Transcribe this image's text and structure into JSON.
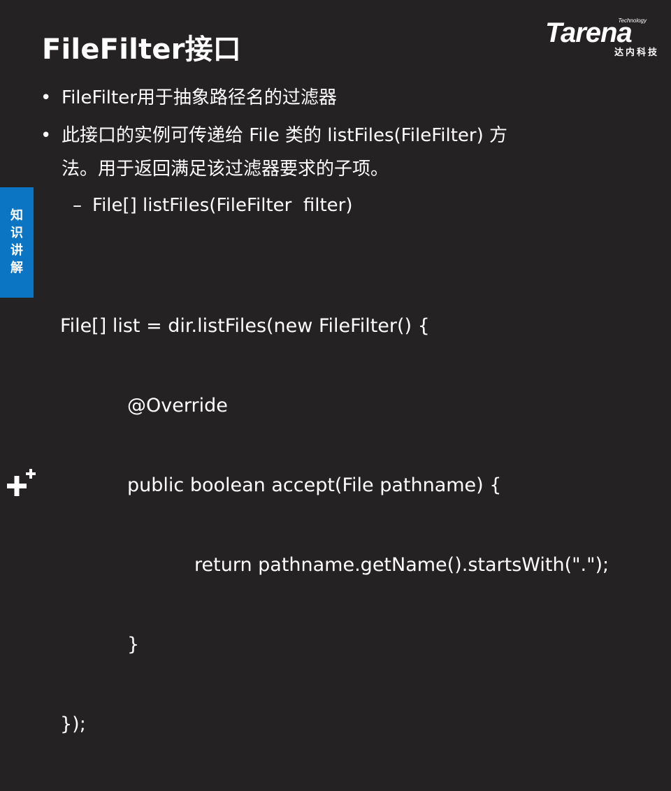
{
  "slide": {
    "title": "FileFilter接口",
    "logo": {
      "technology": "Technology",
      "wordmark": "Tarena",
      "chinese": "达内科技"
    },
    "side_tab": [
      "知",
      "识",
      "讲",
      "解"
    ],
    "bullets": [
      {
        "marker": "•",
        "text": "FileFilter用于抽象路径名的过滤器"
      },
      {
        "marker": "•",
        "line1": "此接口的实例可传递给 File 类的 listFiles(FileFilter) 方",
        "line2": "法。用于返回满足该过滤器要求的子项。"
      }
    ],
    "sub_bullet": {
      "marker": "–",
      "text": "File[] listFiles(FileFilter  filter)"
    },
    "code": [
      "File[] list = dir.listFiles(new FileFilter() {",
      "@Override",
      "public boolean accept(File pathname) {",
      "return pathname.getName().startsWith(\".\");",
      "}",
      "});"
    ],
    "colors": {
      "background": "#252223",
      "text": "#ffffff",
      "side_tab": "#0b74c3"
    },
    "icons": {
      "corner": "plus-icon"
    }
  }
}
